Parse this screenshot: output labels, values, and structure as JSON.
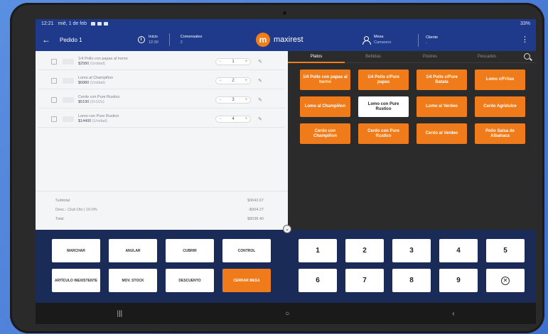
{
  "status": {
    "time": "12:21",
    "date": "mié, 1 de feb",
    "battery": "33%"
  },
  "header": {
    "back_icon": "arrow-left-icon",
    "order_title": "Pedido 1",
    "timer_label": "Inicio",
    "timer_value": "12:30",
    "diners_label": "Comensales",
    "diners_value": "2",
    "brand_name": "maxirest",
    "brand_logo_letter": "m",
    "table_label": "Mesa",
    "table_value": "Camarero",
    "client_label": "Cliente",
    "client_value": "-",
    "menu_icon": "more-vertical-icon"
  },
  "order": {
    "items": [
      {
        "name": "1/4 Pollo con papas al horno",
        "price": "$2580",
        "note": "(Unidad)",
        "qty": "1"
      },
      {
        "name": "Lomo al Champiñon",
        "price": "$6880",
        "note": "(Unidad)",
        "qty": "2"
      },
      {
        "name": "Cerdo con Pure Rustico",
        "price": "$5190",
        "note": "(2x1/2x)",
        "qty": "3"
      },
      {
        "name": "Lomo con Pure Rustico",
        "price": "$14400",
        "note": "(Unidad)",
        "qty": "4"
      }
    ],
    "totals": [
      {
        "label": "Subtotal",
        "value": "$9043.67"
      },
      {
        "label": "Desc.: Club Dto | 10.0%",
        "value": "-$904.27"
      },
      {
        "label": "Total",
        "value": "$8038.40"
      }
    ]
  },
  "menu": {
    "tabs": [
      "Platos",
      "Bebidas",
      "Postres",
      "Pescados"
    ],
    "active_tab": 0,
    "products": [
      "1/4 Pollo con papas al horno",
      "1/4 Pollo c/Pure papas",
      "1/4 Pollo c/Pure Batata",
      "Lomo c/Fritas",
      "Lomo al Champiñon",
      "Lomo con Pure Rustico",
      "Lomo al Verdeo",
      "Cerdo Agridulce",
      "Cerdo con Champiñon",
      "Cerdo con Pure Rustico",
      "Cerdo al Verdeo",
      "Pollo Salsa de Albahaca"
    ],
    "selected_product": 5
  },
  "actions": [
    "MARCHAR",
    "ANULAR",
    "CUBRIR",
    "CONTROL",
    "ARTÍCULO INEXISTENTE",
    "MOV. STOCK",
    "DESCUENTO",
    "CERRAR MESA"
  ],
  "keypad": [
    "1",
    "2",
    "3",
    "4",
    "5",
    "6",
    "7",
    "8",
    "9"
  ],
  "nav": {
    "recents": "|||",
    "home": "○",
    "back": "‹"
  },
  "colors": {
    "accent": "#ef7b1a",
    "header": "#1f3a8a",
    "bottom": "#1b2b57"
  }
}
